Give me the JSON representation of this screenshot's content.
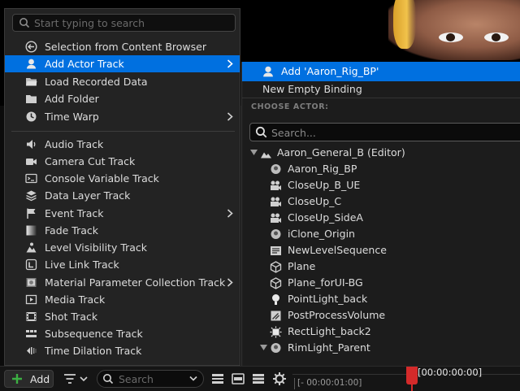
{
  "menu": {
    "search_placeholder": "Start typing to search",
    "items": [
      {
        "label": "Selection from Content Browser",
        "icon": "arrow-left-circle-icon"
      },
      {
        "label": "Add Actor Track",
        "icon": "actor-icon",
        "submenu": true,
        "highlighted": true
      },
      {
        "label": "Load Recorded Data",
        "icon": "folder-open-icon"
      },
      {
        "label": "Add Folder",
        "icon": "folder-icon"
      },
      {
        "label": "Time Warp",
        "icon": "clock-icon",
        "submenu": true
      },
      {
        "label": "Audio Track",
        "icon": "speaker-icon"
      },
      {
        "label": "Camera Cut Track",
        "icon": "camera-cut-icon"
      },
      {
        "label": "Console Variable Track",
        "icon": "console-icon"
      },
      {
        "label": "Data Layer Track",
        "icon": "layers-icon"
      },
      {
        "label": "Event Track",
        "icon": "flag-icon",
        "submenu": true
      },
      {
        "label": "Fade Track",
        "icon": "gradient-icon"
      },
      {
        "label": "Level Visibility Track",
        "icon": "level-visibility-icon"
      },
      {
        "label": "Live Link Track",
        "icon": "live-link-icon"
      },
      {
        "label": "Material Parameter Collection Track",
        "icon": "material-collection-icon",
        "submenu": true
      },
      {
        "label": "Media Track",
        "icon": "media-icon"
      },
      {
        "label": "Shot Track",
        "icon": "film-icon"
      },
      {
        "label": "Subsequence Track",
        "icon": "subsequence-icon"
      },
      {
        "label": "Time Dilation Track",
        "icon": "time-dilation-icon"
      }
    ]
  },
  "actor_submenu": {
    "add_label": "Add 'Aaron_Rig_BP'",
    "empty_binding_label": "New Empty Binding",
    "choose_actor_label": "CHOOSE ACTOR:",
    "search_placeholder": "Search...",
    "tree": [
      {
        "label": "Aaron_General_B (Editor)",
        "icon": "level-icon",
        "expanded": true
      },
      {
        "label": "Aaron_Rig_BP",
        "icon": "actor-icon"
      },
      {
        "label": "CloseUp_B_UE",
        "icon": "camera-icon"
      },
      {
        "label": "CloseUp_C",
        "icon": "camera-icon"
      },
      {
        "label": "CloseUp_SideA",
        "icon": "camera-icon"
      },
      {
        "label": "iClone_Origin",
        "icon": "actor-icon"
      },
      {
        "label": "NewLevelSequence",
        "icon": "sequence-icon"
      },
      {
        "label": "Plane",
        "icon": "static-mesh-icon"
      },
      {
        "label": "Plane_forUI-BG",
        "icon": "static-mesh-icon"
      },
      {
        "label": "PointLight_back",
        "icon": "point-light-icon"
      },
      {
        "label": "PostProcessVolume",
        "icon": "post-process-icon"
      },
      {
        "label": "RectLight_back2",
        "icon": "rect-light-icon"
      },
      {
        "label": "RimLight_Parent",
        "icon": "actor-icon",
        "expanded": true
      }
    ]
  },
  "toolbar": {
    "add_label": "Add",
    "search_placeholder": "Search",
    "timecode_negative": "[- 00:00:01:00]",
    "timecode_current": "[00:00:00:00]"
  },
  "colors": {
    "highlight": "#0070e0",
    "menu_bg": "#232323",
    "add_plus": "#3cb043",
    "playhead": "#d42a2a"
  }
}
